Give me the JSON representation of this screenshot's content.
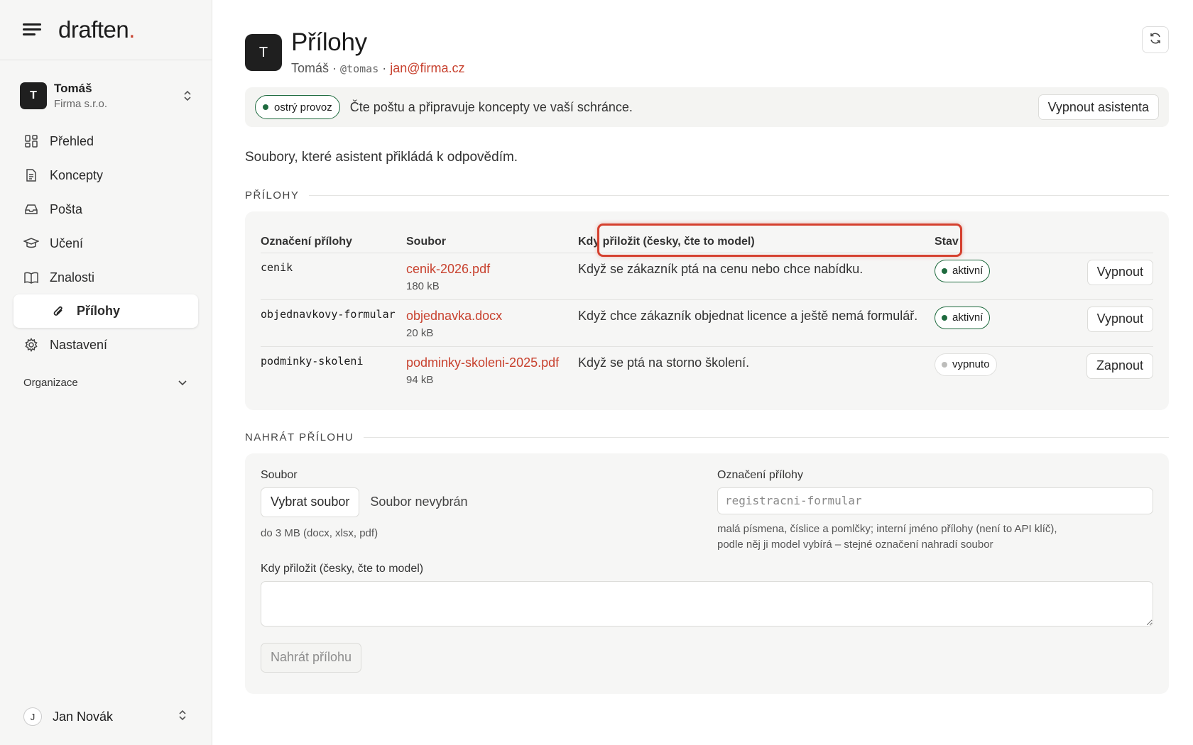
{
  "brand": {
    "name": "draften",
    "dot": "."
  },
  "workspace": {
    "initial": "T",
    "name": "Tomáš",
    "org": "Firma s.r.o."
  },
  "nav": {
    "items": [
      {
        "label": "Přehled",
        "icon": "grid-icon"
      },
      {
        "label": "Koncepty",
        "icon": "document-icon"
      },
      {
        "label": "Pošta",
        "icon": "inbox-icon"
      },
      {
        "label": "Učení",
        "icon": "graduation-cap-icon"
      },
      {
        "label": "Znalosti",
        "icon": "book-icon"
      },
      {
        "label": "Přílohy",
        "icon": "paperclip-icon",
        "active": true
      },
      {
        "label": "Nastavení",
        "icon": "gear-icon"
      }
    ],
    "section": "Organizace"
  },
  "user": {
    "initial": "J",
    "name": "Jan Novák"
  },
  "header": {
    "avatar": "T",
    "title": "Přílohy",
    "name": "Tomáš",
    "sep": "·",
    "handle": "@tomas",
    "email": "jan@firma.cz"
  },
  "banner": {
    "status": "ostrý provoz",
    "text": "Čte poštu a připravuje koncepty ve vaší schránce.",
    "button": "Vypnout asistenta"
  },
  "description": "Soubory, které asistent přikládá k odpovědím.",
  "attachments": {
    "section_title": "PŘÍLOHY",
    "columns": [
      "Označení přílohy",
      "Soubor",
      "Kdy přiložit (česky, čte to model)",
      "Stav"
    ],
    "rows": [
      {
        "label": "cenik",
        "file": "cenik-2026.pdf",
        "size": "180 kB",
        "when": "Když se zákazník ptá na cenu nebo chce nabídku.",
        "status": "aktivní",
        "status_on": true,
        "action": "Vypnout"
      },
      {
        "label": "objednavkovy-formular",
        "file": "objednavka.docx",
        "size": "20 kB",
        "when": "Když chce zákazník objednat licence a ještě nemá formulář.",
        "status": "aktivní",
        "status_on": true,
        "action": "Vypnout"
      },
      {
        "label": "podminky-skoleni",
        "file": "podminky-skoleni-2025.pdf",
        "size": "94 kB",
        "when": "Když se ptá na storno školení.",
        "status": "vypnuto",
        "status_on": false,
        "action": "Zapnout"
      }
    ]
  },
  "upload": {
    "section_title": "NAHRÁT PŘÍLOHU",
    "file_label": "Soubor",
    "choose_button": "Vybrat soubor",
    "no_file": "Soubor nevybrán",
    "file_hint": "do 3 MB (docx, xlsx, pdf)",
    "name_label": "Označení přílohy",
    "name_placeholder": "registracni-formular",
    "name_hint_1": "malá písmena, číslice a pomlčky; interní jméno přílohy (není to API klíč),",
    "name_hint_2": "podle něj ji model vybírá – stejné označení nahradí soubor",
    "when_label": "Kdy přiložit (česky, čte to model)",
    "submit": "Nahrát přílohu"
  },
  "colors": {
    "accent": "#c8422f",
    "active_green": "#1f6b3f",
    "highlight": "#d5412f"
  }
}
